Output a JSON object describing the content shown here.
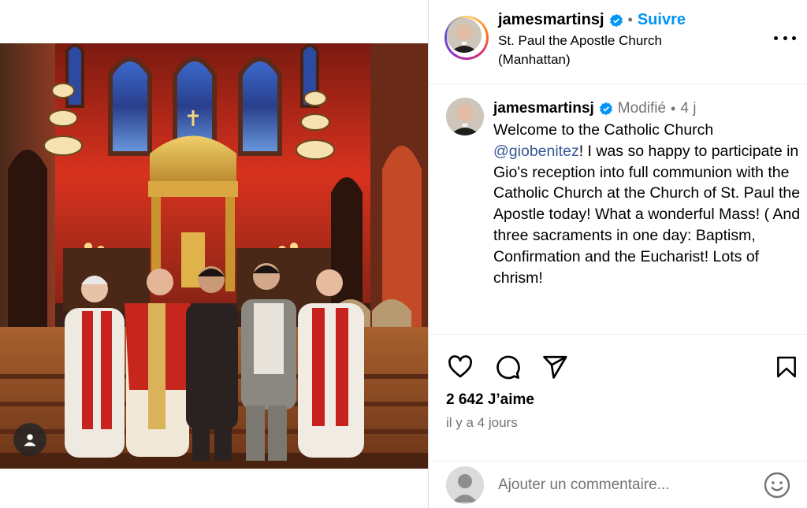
{
  "post": {
    "username": "jamesmartinsj",
    "follow_label": "Suivre",
    "separator": "•",
    "location": "St. Paul the Apostle Church (Manhattan)"
  },
  "caption": {
    "username": "jamesmartinsj",
    "edited_label": "Modifié",
    "separator": "•",
    "time": "4 j",
    "text_before_mention": "Welcome to the Catholic Church ",
    "mention": "@giobenitez",
    "text_after_mention": "! I was so happy to participate in Gio's reception into full communion with the Catholic Church at the Church of St. Paul the Apostle today! What a wonderful Mass! ( And three sacraments in one day: Baptism, Confirmation and the Eucharist! Lots of chrism!"
  },
  "stats": {
    "likes": "2 642 J’aime",
    "posted_ago": "il y a 4 jours"
  },
  "comment": {
    "placeholder": "Ajouter un commentaire..."
  },
  "icons": {
    "verified": "verified-badge-icon",
    "more": "more-options-icon",
    "like": "heart-icon",
    "comment": "comment-icon",
    "share": "share-icon",
    "save": "bookmark-icon",
    "emoji": "emoji-icon",
    "tag": "user-tag-icon"
  },
  "colors": {
    "accent": "#0095f6",
    "verified": "#0095f6",
    "secondary_text": "#737373",
    "mention": "#385898"
  }
}
